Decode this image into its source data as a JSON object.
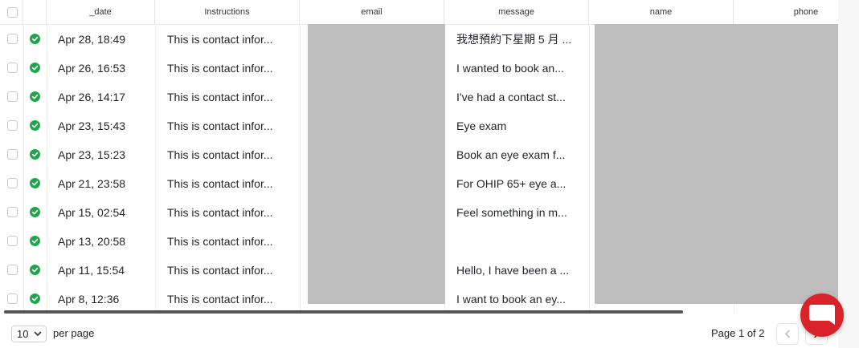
{
  "table": {
    "columns": [
      "_date",
      "Instructions",
      "email",
      "message",
      "name",
      "phone"
    ],
    "rows": [
      {
        "date": "Apr 28, 18:49",
        "instructions": "This is contact infor...",
        "message": "我想預約下星期 5 月 ..."
      },
      {
        "date": "Apr 26, 16:53",
        "instructions": "This is contact infor...",
        "message": "I wanted to book an..."
      },
      {
        "date": "Apr 26, 14:17",
        "instructions": "This is contact infor...",
        "message": "I've had a contact st..."
      },
      {
        "date": "Apr 23, 15:43",
        "instructions": "This is contact infor...",
        "message": "Eye exam"
      },
      {
        "date": "Apr 23, 15:23",
        "instructions": "This is contact infor...",
        "message": "Book an eye exam f..."
      },
      {
        "date": "Apr 21, 23:58",
        "instructions": "This is contact infor...",
        "message": "For OHIP 65+ eye a..."
      },
      {
        "date": "Apr 15, 02:54",
        "instructions": "This is contact infor...",
        "message": "Feel something in m..."
      },
      {
        "date": "Apr 13, 20:58",
        "instructions": "This is contact infor...",
        "message": ""
      },
      {
        "date": "Apr 11, 15:54",
        "instructions": "This is contact infor...",
        "message": "Hello, I have been a ..."
      },
      {
        "date": "Apr 8, 12:36",
        "instructions": "This is contact infor...",
        "message": "I want to book an ey..."
      }
    ]
  },
  "footer": {
    "per_page_value": "10",
    "per_page_label": "per page",
    "page_info": "Page 1 of 2"
  },
  "colors": {
    "status_ok": "#1fa64a",
    "chat_button": "#d8232a",
    "redaction": "#bdbdbd"
  },
  "icons": [
    "check-circle-icon",
    "chevron-down-icon",
    "chevron-left-icon",
    "chevron-right-icon",
    "chat-bubble-icon"
  ]
}
